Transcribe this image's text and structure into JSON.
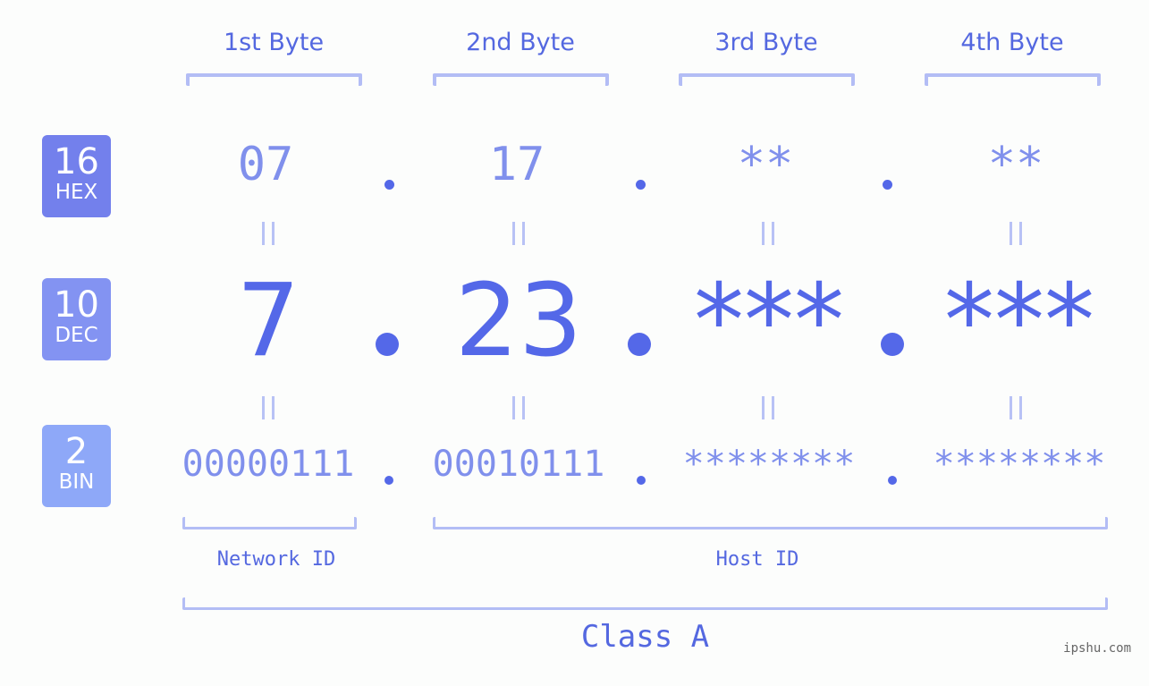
{
  "colors": {
    "accent": "#5468e8",
    "hex_badge": "#7380ec",
    "dec_badge": "#8393f2",
    "bin_badge": "#8ea8f8",
    "bracket": "#b3bdf5",
    "value_light": "#8090ec",
    "background": "#fcfdfc"
  },
  "byte_headers": [
    "1st Byte",
    "2nd Byte",
    "3rd Byte",
    "4th Byte"
  ],
  "badges": {
    "hex": {
      "num": "16",
      "label": "HEX"
    },
    "dec": {
      "num": "10",
      "label": "DEC"
    },
    "bin": {
      "num": "2",
      "label": "BIN"
    }
  },
  "hex_values": [
    "07",
    "17",
    "**",
    "**"
  ],
  "dec_values": [
    "7",
    "23",
    "***",
    "***"
  ],
  "bin_values": [
    "00000111",
    "00010111",
    "********",
    "********"
  ],
  "separator": ".",
  "equals_symbol": "||",
  "network_id_label": "Network ID",
  "host_id_label": "Host ID",
  "class_label": "Class A",
  "watermark": "ipshu.com"
}
